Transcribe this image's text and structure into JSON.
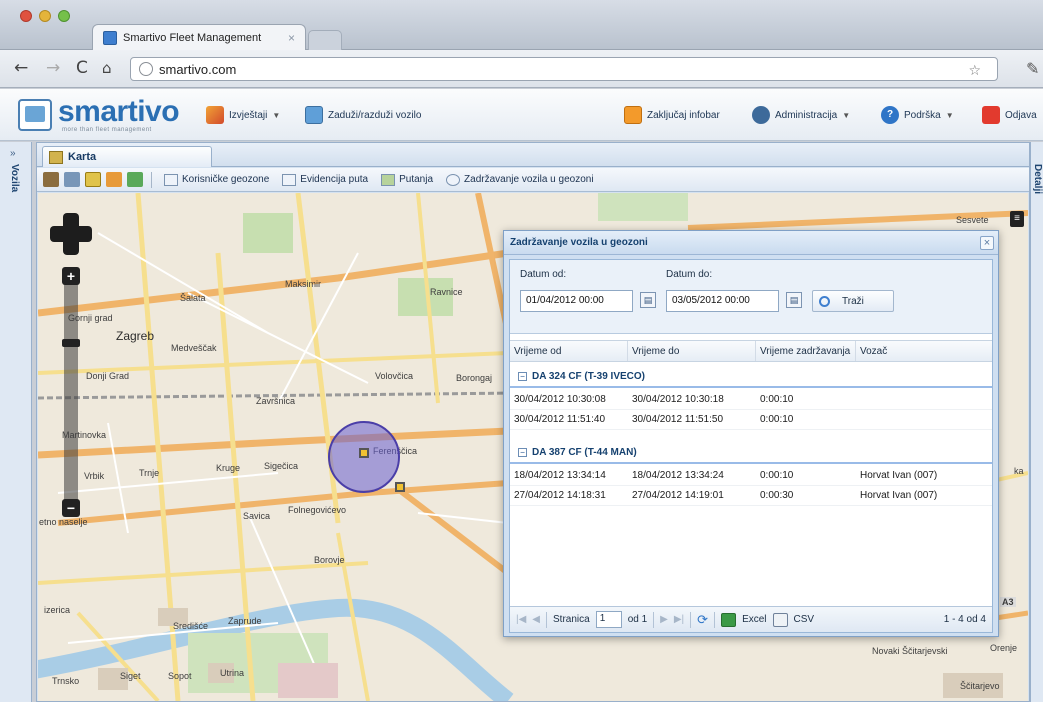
{
  "browser": {
    "tab_title": "Smartivo Fleet Management",
    "url": "smartivo.com"
  },
  "header": {
    "logo": "smartivo",
    "tagline": "more than fleet management",
    "menu": {
      "reports": "Izvještaji",
      "assign": "Zaduži/razduži vozilo",
      "lock": "Zaključaj infobar",
      "admin": "Administracija",
      "support": "Podrška",
      "logout": "Odjava"
    }
  },
  "side": {
    "west_label": "Vozila",
    "east_label": "Detalji"
  },
  "main_tab": "Karta",
  "toolbar": {
    "geozones": "Korisničke geozone",
    "trip_log": "Evidencija puta",
    "route": "Putanja",
    "retention": "Zadržavanje vozila u geozoni"
  },
  "map": {
    "labels": {
      "sesvete": "Sesvete",
      "maksimir": "Maksimir",
      "salata": "Šalata",
      "ravnice": "Ravnice",
      "gornji_grad": "Gornji grad",
      "zagreb": "Zagreb",
      "medvescak": "Medveščak",
      "donji_grad": "Donji Grad",
      "volovcica": "Volovčica",
      "borongaj": "Borongaj",
      "zavrtnica": "Završnica",
      "martinovka": "Martinovka",
      "vrbik": "Vrbik",
      "trnje": "Trnje",
      "kruge": "Kruge",
      "sigecica": "Sigečica",
      "ferenscica": "Ferenščica",
      "savica": "Savica",
      "folnegoviceva": "Folnegovićevo",
      "etno": "etno naselje",
      "borovje": "Borovje",
      "sredisce": "Središće",
      "zaprude": "Zaprude",
      "utrina": "Utrina",
      "sopot": "Sopot",
      "siget": "Siget",
      "trnsko": "Trnsko",
      "novaki": "Novaki Ščitarjevski",
      "scitarjevo": "Ščitarjevo",
      "orenje": "Orenje",
      "zerica": "izerica",
      "ka": "ka",
      "a3": "A3"
    }
  },
  "dialog": {
    "title": "Zadržavanje vozila u geozoni",
    "date_from_label": "Datum od:",
    "date_to_label": "Datum do:",
    "date_from": "01/04/2012 00:00",
    "date_to": "03/05/2012 00:00",
    "search": "Traži",
    "columns": [
      "Vrijeme od",
      "Vrijeme do",
      "Vrijeme zadržavanja",
      "Vozač"
    ],
    "groups": [
      {
        "name": "DA 324 CF (T-39 IVECO)",
        "rows": [
          [
            "30/04/2012 10:30:08",
            "30/04/2012 10:30:18",
            "0:00:10",
            ""
          ],
          [
            "30/04/2012 11:51:40",
            "30/04/2012 11:51:50",
            "0:00:10",
            ""
          ]
        ]
      },
      {
        "name": "DA 387 CF (T-44 MAN)",
        "rows": [
          [
            "18/04/2012 13:34:14",
            "18/04/2012 13:34:24",
            "0:00:10",
            "Horvat Ivan (007)"
          ],
          [
            "27/04/2012 14:18:31",
            "27/04/2012 14:19:01",
            "0:00:30",
            "Horvat Ivan (007)"
          ]
        ]
      }
    ],
    "pager": {
      "page_label": "Stranica",
      "page": "1",
      "of": "od 1",
      "excel": "Excel",
      "csv": "CSV",
      "summary": "1 - 4 od 4"
    }
  }
}
